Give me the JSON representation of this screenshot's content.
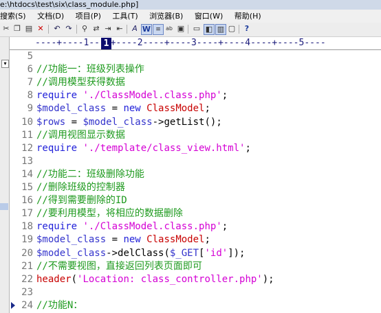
{
  "window": {
    "title": "e:\\htdocs\\test\\six\\class_module.php]"
  },
  "menu": [
    "搜索(S)",
    "文档(D)",
    "项目(P)",
    "工具(T)",
    "浏览器(B)",
    "窗口(W)",
    "帮助(H)"
  ],
  "ruler": {
    "text": "----+----1----+----2----+----3----+----4----+----5----",
    "current_column": "1"
  },
  "code_lines": [
    {
      "num": "5",
      "tokens": []
    },
    {
      "num": "6",
      "tokens": [
        {
          "t": "//功能一：班级列表操作",
          "c": "c-comment"
        }
      ]
    },
    {
      "num": "7",
      "tokens": [
        {
          "t": "//调用模型获得数据",
          "c": "c-comment"
        }
      ]
    },
    {
      "num": "8",
      "tokens": [
        {
          "t": "require ",
          "c": "c-kw"
        },
        {
          "t": "'./ClassModel.class.php'",
          "c": "c-str"
        },
        {
          "t": ";",
          "c": "c-op"
        }
      ]
    },
    {
      "num": "9",
      "tokens": [
        {
          "t": "$model_class",
          "c": "c-var"
        },
        {
          "t": " = ",
          "c": "c-op"
        },
        {
          "t": "new ",
          "c": "c-kw"
        },
        {
          "t": "ClassModel",
          "c": "c-fn"
        },
        {
          "t": ";",
          "c": "c-op"
        }
      ]
    },
    {
      "num": "10",
      "tokens": [
        {
          "t": "$rows",
          "c": "c-var"
        },
        {
          "t": " = ",
          "c": "c-op"
        },
        {
          "t": "$model_class",
          "c": "c-var"
        },
        {
          "t": "->",
          "c": "c-op"
        },
        {
          "t": "getList",
          "c": "c-op"
        },
        {
          "t": "();",
          "c": "c-op"
        }
      ]
    },
    {
      "num": "11",
      "tokens": [
        {
          "t": "//调用视图显示数据",
          "c": "c-comment"
        }
      ]
    },
    {
      "num": "12",
      "tokens": [
        {
          "t": "require ",
          "c": "c-kw"
        },
        {
          "t": "'./template/class_view.html'",
          "c": "c-str"
        },
        {
          "t": ";",
          "c": "c-op"
        }
      ]
    },
    {
      "num": "13",
      "tokens": []
    },
    {
      "num": "14",
      "tokens": [
        {
          "t": "//功能二：班级删除功能",
          "c": "c-comment"
        }
      ]
    },
    {
      "num": "15",
      "tokens": [
        {
          "t": "//删除班级的控制器",
          "c": "c-comment"
        }
      ]
    },
    {
      "num": "16",
      "tokens": [
        {
          "t": "//得到需要删除的ID",
          "c": "c-comment"
        }
      ]
    },
    {
      "num": "17",
      "tokens": [
        {
          "t": "//要利用模型，将相应的数据删除",
          "c": "c-comment"
        }
      ]
    },
    {
      "num": "18",
      "tokens": [
        {
          "t": "require ",
          "c": "c-kw"
        },
        {
          "t": "'./ClassModel.class.php'",
          "c": "c-str"
        },
        {
          "t": ";",
          "c": "c-op"
        }
      ]
    },
    {
      "num": "19",
      "tokens": [
        {
          "t": "$model_class",
          "c": "c-var"
        },
        {
          "t": " = ",
          "c": "c-op"
        },
        {
          "t": "new ",
          "c": "c-kw"
        },
        {
          "t": "ClassModel",
          "c": "c-fn"
        },
        {
          "t": ";",
          "c": "c-op"
        }
      ]
    },
    {
      "num": "20",
      "tokens": [
        {
          "t": "$model_class",
          "c": "c-var"
        },
        {
          "t": "->",
          "c": "c-op"
        },
        {
          "t": "delClass",
          "c": "c-op"
        },
        {
          "t": "(",
          "c": "c-op"
        },
        {
          "t": "$_GET",
          "c": "c-var"
        },
        {
          "t": "[",
          "c": "c-op"
        },
        {
          "t": "'id'",
          "c": "c-str"
        },
        {
          "t": "]);",
          "c": "c-op"
        }
      ]
    },
    {
      "num": "21",
      "tokens": [
        {
          "t": "//不需要视图，直接返回列表页面即可",
          "c": "c-comment"
        }
      ]
    },
    {
      "num": "22",
      "tokens": [
        {
          "t": "header",
          "c": "c-fn"
        },
        {
          "t": "(",
          "c": "c-op"
        },
        {
          "t": "'Location: class_controller.php'",
          "c": "c-str"
        },
        {
          "t": ");",
          "c": "c-op"
        }
      ]
    },
    {
      "num": "23",
      "tokens": []
    },
    {
      "num": "24",
      "tokens": [
        {
          "t": "//功能N：",
          "c": "c-comment"
        }
      ]
    }
  ],
  "colors": {
    "comment": "#1e9a1e",
    "keyword": "#1f1fd9",
    "string": "#d400d4",
    "variable": "#3333cc",
    "class_name": "#c80000"
  },
  "toolbar_icons": [
    "cut-icon",
    "copy-icon",
    "paste-icon",
    "delete-icon",
    "undo-icon",
    "redo-icon",
    "find-icon",
    "replace-icon",
    "indent-icon",
    "font-icon",
    "wordwrap-icon",
    "linenumber-icon",
    "spellcheck-icon",
    "convert-icon",
    "view1-icon",
    "view2-icon",
    "view3-icon",
    "view4-icon",
    "help-icon"
  ]
}
